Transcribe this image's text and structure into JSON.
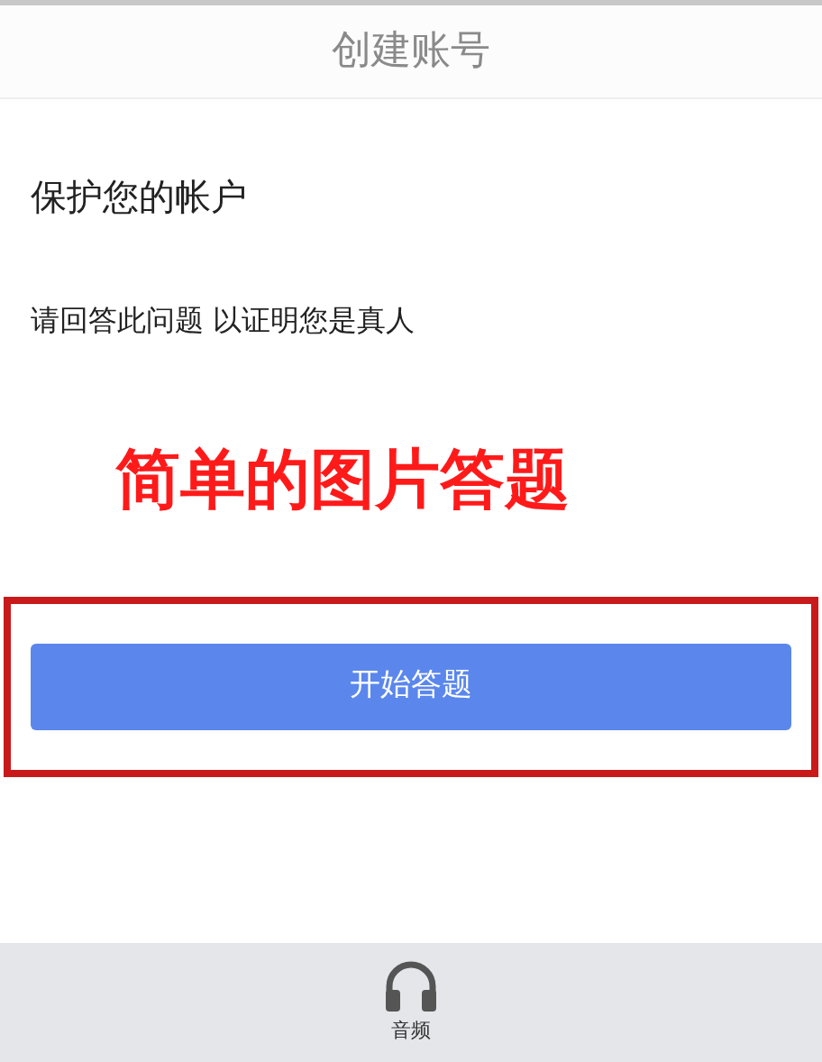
{
  "header": {
    "title": "创建账号"
  },
  "heading": "保护您的帐户",
  "prompt": "请回答此问题 以证明您是真人",
  "annotation": {
    "text": "简单的图片答题"
  },
  "start_button": {
    "label": "开始答题"
  },
  "bottom_bar": {
    "items": [
      {
        "kind": "audio",
        "label": "音频"
      }
    ]
  }
}
